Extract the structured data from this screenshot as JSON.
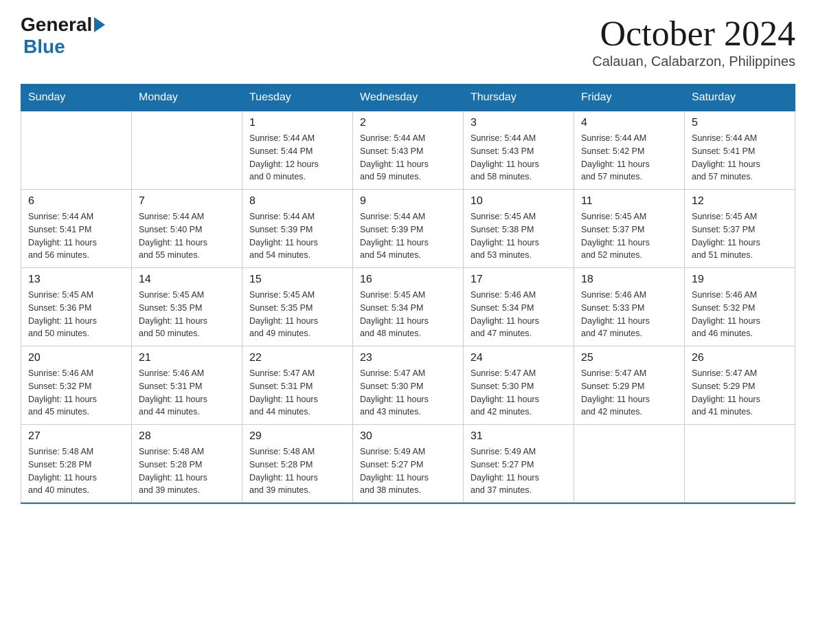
{
  "logo": {
    "general": "General",
    "blue": "Blue"
  },
  "title": "October 2024",
  "subtitle": "Calauan, Calabarzon, Philippines",
  "days_header": [
    "Sunday",
    "Monday",
    "Tuesday",
    "Wednesday",
    "Thursday",
    "Friday",
    "Saturday"
  ],
  "weeks": [
    [
      {
        "day": "",
        "info": ""
      },
      {
        "day": "",
        "info": ""
      },
      {
        "day": "1",
        "info": "Sunrise: 5:44 AM\nSunset: 5:44 PM\nDaylight: 12 hours\nand 0 minutes."
      },
      {
        "day": "2",
        "info": "Sunrise: 5:44 AM\nSunset: 5:43 PM\nDaylight: 11 hours\nand 59 minutes."
      },
      {
        "day": "3",
        "info": "Sunrise: 5:44 AM\nSunset: 5:43 PM\nDaylight: 11 hours\nand 58 minutes."
      },
      {
        "day": "4",
        "info": "Sunrise: 5:44 AM\nSunset: 5:42 PM\nDaylight: 11 hours\nand 57 minutes."
      },
      {
        "day": "5",
        "info": "Sunrise: 5:44 AM\nSunset: 5:41 PM\nDaylight: 11 hours\nand 57 minutes."
      }
    ],
    [
      {
        "day": "6",
        "info": "Sunrise: 5:44 AM\nSunset: 5:41 PM\nDaylight: 11 hours\nand 56 minutes."
      },
      {
        "day": "7",
        "info": "Sunrise: 5:44 AM\nSunset: 5:40 PM\nDaylight: 11 hours\nand 55 minutes."
      },
      {
        "day": "8",
        "info": "Sunrise: 5:44 AM\nSunset: 5:39 PM\nDaylight: 11 hours\nand 54 minutes."
      },
      {
        "day": "9",
        "info": "Sunrise: 5:44 AM\nSunset: 5:39 PM\nDaylight: 11 hours\nand 54 minutes."
      },
      {
        "day": "10",
        "info": "Sunrise: 5:45 AM\nSunset: 5:38 PM\nDaylight: 11 hours\nand 53 minutes."
      },
      {
        "day": "11",
        "info": "Sunrise: 5:45 AM\nSunset: 5:37 PM\nDaylight: 11 hours\nand 52 minutes."
      },
      {
        "day": "12",
        "info": "Sunrise: 5:45 AM\nSunset: 5:37 PM\nDaylight: 11 hours\nand 51 minutes."
      }
    ],
    [
      {
        "day": "13",
        "info": "Sunrise: 5:45 AM\nSunset: 5:36 PM\nDaylight: 11 hours\nand 50 minutes."
      },
      {
        "day": "14",
        "info": "Sunrise: 5:45 AM\nSunset: 5:35 PM\nDaylight: 11 hours\nand 50 minutes."
      },
      {
        "day": "15",
        "info": "Sunrise: 5:45 AM\nSunset: 5:35 PM\nDaylight: 11 hours\nand 49 minutes."
      },
      {
        "day": "16",
        "info": "Sunrise: 5:45 AM\nSunset: 5:34 PM\nDaylight: 11 hours\nand 48 minutes."
      },
      {
        "day": "17",
        "info": "Sunrise: 5:46 AM\nSunset: 5:34 PM\nDaylight: 11 hours\nand 47 minutes."
      },
      {
        "day": "18",
        "info": "Sunrise: 5:46 AM\nSunset: 5:33 PM\nDaylight: 11 hours\nand 47 minutes."
      },
      {
        "day": "19",
        "info": "Sunrise: 5:46 AM\nSunset: 5:32 PM\nDaylight: 11 hours\nand 46 minutes."
      }
    ],
    [
      {
        "day": "20",
        "info": "Sunrise: 5:46 AM\nSunset: 5:32 PM\nDaylight: 11 hours\nand 45 minutes."
      },
      {
        "day": "21",
        "info": "Sunrise: 5:46 AM\nSunset: 5:31 PM\nDaylight: 11 hours\nand 44 minutes."
      },
      {
        "day": "22",
        "info": "Sunrise: 5:47 AM\nSunset: 5:31 PM\nDaylight: 11 hours\nand 44 minutes."
      },
      {
        "day": "23",
        "info": "Sunrise: 5:47 AM\nSunset: 5:30 PM\nDaylight: 11 hours\nand 43 minutes."
      },
      {
        "day": "24",
        "info": "Sunrise: 5:47 AM\nSunset: 5:30 PM\nDaylight: 11 hours\nand 42 minutes."
      },
      {
        "day": "25",
        "info": "Sunrise: 5:47 AM\nSunset: 5:29 PM\nDaylight: 11 hours\nand 42 minutes."
      },
      {
        "day": "26",
        "info": "Sunrise: 5:47 AM\nSunset: 5:29 PM\nDaylight: 11 hours\nand 41 minutes."
      }
    ],
    [
      {
        "day": "27",
        "info": "Sunrise: 5:48 AM\nSunset: 5:28 PM\nDaylight: 11 hours\nand 40 minutes."
      },
      {
        "day": "28",
        "info": "Sunrise: 5:48 AM\nSunset: 5:28 PM\nDaylight: 11 hours\nand 39 minutes."
      },
      {
        "day": "29",
        "info": "Sunrise: 5:48 AM\nSunset: 5:28 PM\nDaylight: 11 hours\nand 39 minutes."
      },
      {
        "day": "30",
        "info": "Sunrise: 5:49 AM\nSunset: 5:27 PM\nDaylight: 11 hours\nand 38 minutes."
      },
      {
        "day": "31",
        "info": "Sunrise: 5:49 AM\nSunset: 5:27 PM\nDaylight: 11 hours\nand 37 minutes."
      },
      {
        "day": "",
        "info": ""
      },
      {
        "day": "",
        "info": ""
      }
    ]
  ]
}
